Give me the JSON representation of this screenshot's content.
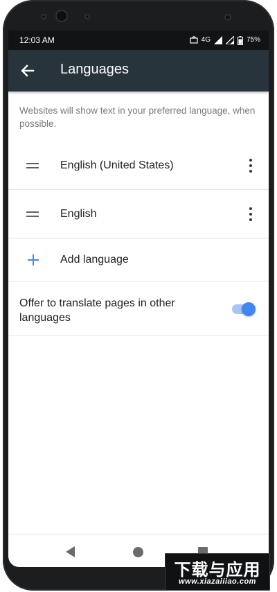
{
  "status_bar": {
    "time": "12:03 AM",
    "network": "4G",
    "battery": "75%"
  },
  "header": {
    "back_icon": "arrow-left-icon",
    "title": "Languages"
  },
  "content": {
    "description": "Websites will show text in your preferred language, when possible.",
    "languages": [
      {
        "label": "English (United States)"
      },
      {
        "label": "English"
      }
    ],
    "add_language_label": "Add language",
    "translate": {
      "label": "Offer to translate pages in other languages",
      "enabled": true
    }
  },
  "watermark": {
    "text_cn": "下载与应用",
    "url": "www.xiazaiiiao.com"
  },
  "colors": {
    "app_bar": "#27343c",
    "accent": "#4285f4",
    "status_bar": "#111315"
  }
}
